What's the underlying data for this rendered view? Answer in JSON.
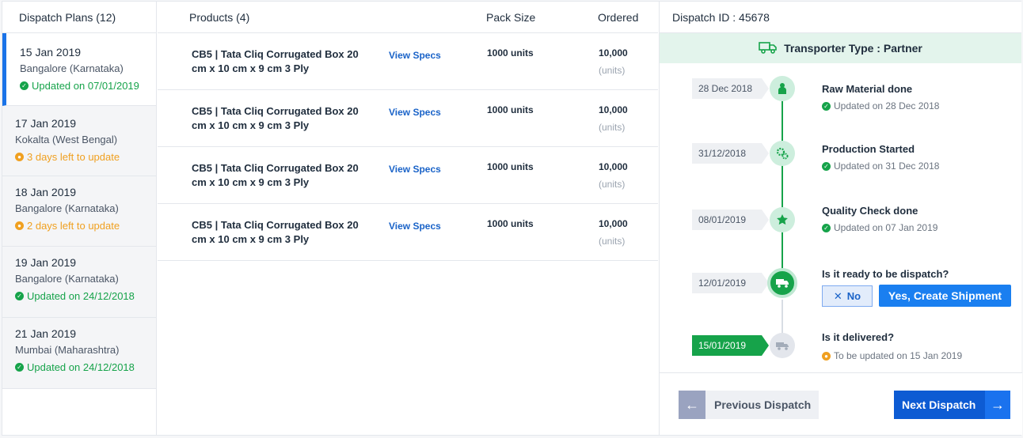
{
  "plans_panel": {
    "title": "Dispatch Plans (12)",
    "plans": [
      {
        "date": "15 Jan 2019",
        "location": "Bangalore (Karnataka)",
        "status": "Updated on 07/01/2019",
        "status_type": "done",
        "active": true
      },
      {
        "date": "17 Jan 2019",
        "location": "Kokalta (West Bengal)",
        "status": "3 days left to update",
        "status_type": "pending",
        "active": false
      },
      {
        "date": "18 Jan 2019",
        "location": "Bangalore (Karnataka)",
        "status": "2 days left to update",
        "status_type": "pending",
        "active": false
      },
      {
        "date": "19 Jan 2019",
        "location": "Bangalore (Karnataka)",
        "status": "Updated on 24/12/2018",
        "status_type": "done",
        "active": false
      },
      {
        "date": "21 Jan 2019",
        "location": "Mumbai (Maharashtra)",
        "status": "Updated on 24/12/2018",
        "status_type": "done",
        "active": false
      }
    ]
  },
  "products_panel": {
    "col_products": "Products (4)",
    "col_pack": "Pack Size",
    "col_ordered": "Ordered",
    "rows": [
      {
        "name": "CB5 | Tata Cliq Corrugated Box 20 cm x 10 cm x 9 cm 3 Ply",
        "link": "View Specs",
        "pack": "1000 units",
        "ordered": "10,000",
        "unit": "(units)"
      },
      {
        "name": "CB5 | Tata Cliq Corrugated Box 20 cm x 10 cm x 9 cm 3 Ply",
        "link": "View Specs",
        "pack": "1000 units",
        "ordered": "10,000",
        "unit": "(units)"
      },
      {
        "name": "CB5 | Tata Cliq Corrugated Box 20 cm x 10 cm x 9 cm 3 Ply",
        "link": "View Specs",
        "pack": "1000 units",
        "ordered": "10,000",
        "unit": "(units)"
      },
      {
        "name": "CB5 | Tata Cliq Corrugated Box 20 cm x 10 cm x 9 cm 3 Ply",
        "link": "View Specs",
        "pack": "1000 units",
        "ordered": "10,000",
        "unit": "(units)"
      }
    ]
  },
  "dispatch_panel": {
    "title": "Dispatch ID : 45678",
    "transporter": "Transporter Type : Partner",
    "steps": [
      {
        "date": "28 Dec 2018",
        "title": "Raw Material done",
        "sub": "Updated on 28 Dec 2018",
        "icon": "raw-material-icon"
      },
      {
        "date": "31/12/2018",
        "title": "Production Started",
        "sub": "Updated on 31 Dec 2018",
        "icon": "gears-icon"
      },
      {
        "date": "08/01/2019",
        "title": "Quality Check done",
        "sub": "Updated on 07 Jan 2019",
        "icon": "star-icon"
      },
      {
        "date": "12/01/2019",
        "title": "Is it ready to be dispatch?",
        "icon": "truck-icon"
      },
      {
        "date": "15/01/2019",
        "title": "Is it delivered?",
        "sub": "To be updated on 15 Jan 2019",
        "icon": "delivery-truck-icon"
      }
    ],
    "no_label": "No",
    "yes_label": "Yes, Create Shipment",
    "prev_label": "Previous Dispatch",
    "next_label": "Next Dispatch"
  },
  "colors": {
    "accent": "#1a7ff0",
    "success": "#16a34a",
    "warning": "#f0a020",
    "banner": "#e3f4ec"
  }
}
